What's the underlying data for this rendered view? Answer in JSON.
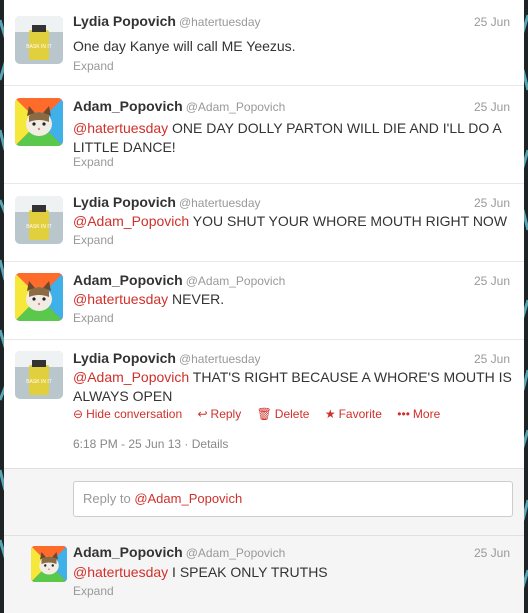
{
  "tweets": [
    {
      "name": "Lydia Popovich",
      "handle": "@hatertuesday",
      "date": "25 Jun",
      "mention": "",
      "text": "One day Kanye will call ME Yeezus.",
      "expand": "Expand"
    },
    {
      "name": "Adam_Popovich",
      "handle": "@Adam_Popovich",
      "date": "25 Jun",
      "mention": "@hatertuesday",
      "text": " ONE DAY DOLLY PARTON WILL DIE AND I'LL DO A LITTLE DANCE!",
      "expand": "Expand"
    },
    {
      "name": "Lydia Popovich",
      "handle": "@hatertuesday",
      "date": "25 Jun",
      "mention": "@Adam_Popovich",
      "text": " YOU SHUT YOUR WHORE MOUTH RIGHT NOW",
      "expand": "Expand"
    },
    {
      "name": "Adam_Popovich",
      "handle": "@Adam_Popovich",
      "date": "25 Jun",
      "mention": "@hatertuesday",
      "text": " NEVER.",
      "expand": "Expand"
    },
    {
      "name": "Lydia Popovich",
      "handle": "@hatertuesday",
      "date": "25 Jun",
      "mention": "@Adam_Popovich",
      "text": " THAT'S RIGHT BECAUSE A WHORE'S MOUTH IS ALWAYS OPEN",
      "actions": {
        "hide": "Hide conversation",
        "reply": "Reply",
        "delete": "Delete",
        "favorite": "Favorite",
        "more": "More"
      },
      "timestamp": "6:18 PM - 25 Jun 13",
      "details": "Details"
    }
  ],
  "reply_box": {
    "prefix": "Reply to ",
    "mention": "@Adam_Popovich"
  },
  "reply_tweet": {
    "name": "Adam_Popovich",
    "handle": "@Adam_Popovich",
    "date": "25 Jun",
    "mention": "@hatertuesday",
    "text": " I SPEAK ONLY TRUTHS",
    "expand": "Expand"
  },
  "avatar_texts": {
    "lydia": "BASK IN IT"
  },
  "colors": {
    "accent": "#d0302b",
    "muted": "#999999",
    "background": "#1e2426"
  }
}
